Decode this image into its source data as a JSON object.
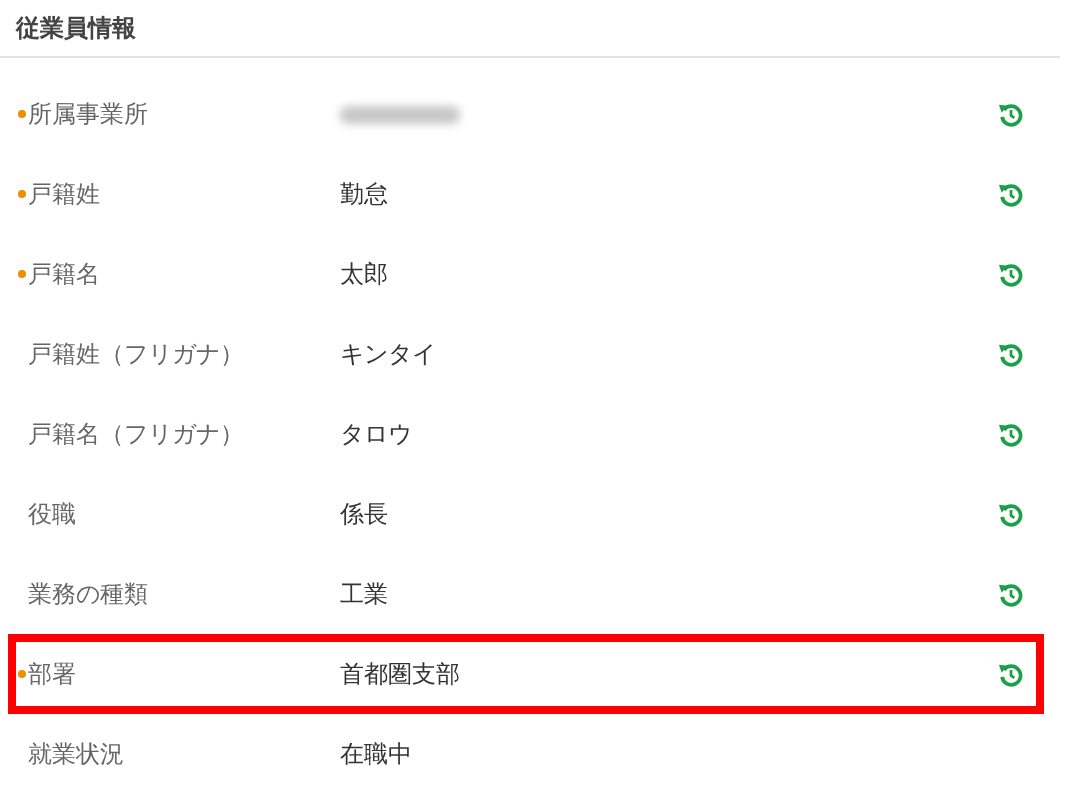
{
  "section": {
    "title": "従業員情報"
  },
  "rows": [
    {
      "label": "所属事業所",
      "required": true,
      "redacted": true,
      "history": true,
      "highlighted": false
    },
    {
      "label": "戸籍姓",
      "value": "勤怠",
      "required": true,
      "history": true,
      "highlighted": false
    },
    {
      "label": "戸籍名",
      "value": "太郎",
      "required": true,
      "history": true,
      "highlighted": false
    },
    {
      "label": "戸籍姓（フリガナ）",
      "value": "キンタイ",
      "required": false,
      "history": true,
      "highlighted": false
    },
    {
      "label": "戸籍名（フリガナ）",
      "value": "タロウ",
      "required": false,
      "history": true,
      "highlighted": false
    },
    {
      "label": "役職",
      "value": "係長",
      "required": false,
      "history": true,
      "highlighted": false
    },
    {
      "label": "業務の種類",
      "value": "工業",
      "required": false,
      "history": true,
      "highlighted": false
    },
    {
      "label": "部署",
      "value": "首都圏支部",
      "required": true,
      "history": true,
      "highlighted": true
    },
    {
      "label": "就業状況",
      "value": "在職中",
      "required": false,
      "history": false,
      "highlighted": false
    }
  ]
}
